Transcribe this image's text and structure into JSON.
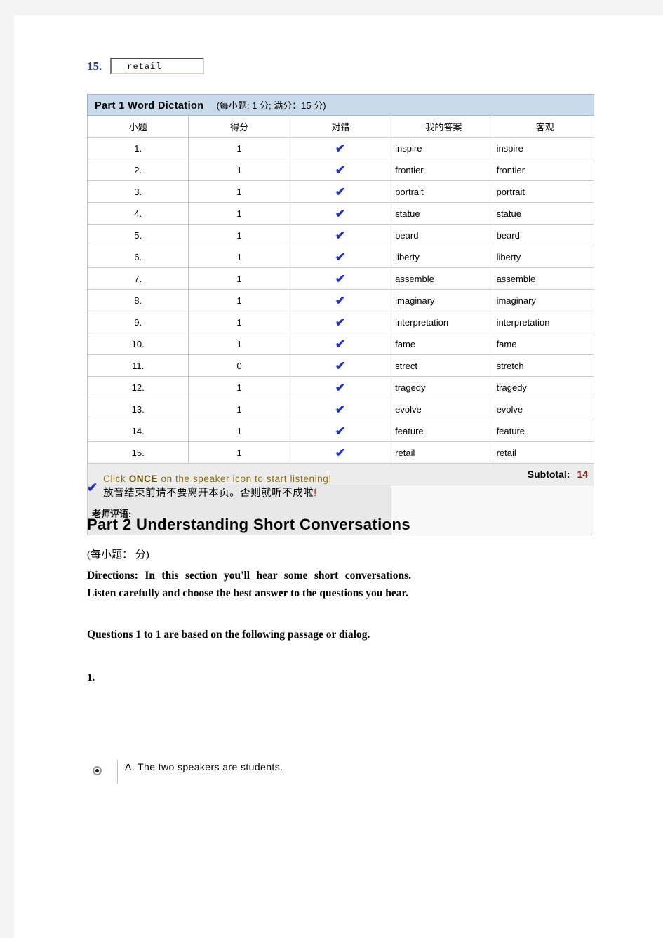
{
  "question15": {
    "number": "15.",
    "input_value": "retail",
    "input_placeholder": ""
  },
  "results_table": {
    "title_main": "Part 1 Word Dictation",
    "title_sub": "(每小题: 1 分; 满分：15 分)",
    "columns": [
      "小题",
      "得分",
      "对错",
      "我的答案",
      "客观"
    ],
    "mark_icon": "check-icon",
    "mark_glyph": "✔",
    "rows": [
      {
        "num": "1.",
        "score": "1",
        "mark": "✔",
        "mine": "inspire",
        "key": "inspire"
      },
      {
        "num": "2.",
        "score": "1",
        "mark": "✔",
        "mine": "frontier",
        "key": "frontier"
      },
      {
        "num": "3.",
        "score": "1",
        "mark": "✔",
        "mine": "portrait",
        "key": "portrait"
      },
      {
        "num": "4.",
        "score": "1",
        "mark": "✔",
        "mine": "statue",
        "key": "statue"
      },
      {
        "num": "5.",
        "score": "1",
        "mark": "✔",
        "mine": "beard",
        "key": "beard"
      },
      {
        "num": "6.",
        "score": "1",
        "mark": "✔",
        "mine": "liberty",
        "key": "liberty"
      },
      {
        "num": "7.",
        "score": "1",
        "mark": "✔",
        "mine": "assemble",
        "key": "assemble"
      },
      {
        "num": "8.",
        "score": "1",
        "mark": "✔",
        "mine": "imaginary",
        "key": "imaginary"
      },
      {
        "num": "9.",
        "score": "1",
        "mark": "✔",
        "mine": "interpretation",
        "key": "interpretation"
      },
      {
        "num": "10.",
        "score": "1",
        "mark": "✔",
        "mine": "fame",
        "key": "fame"
      },
      {
        "num": "11.",
        "score": "0",
        "mark": "✔",
        "mine": "strect",
        "key": "stretch"
      },
      {
        "num": "12.",
        "score": "1",
        "mark": "✔",
        "mine": "tragedy",
        "key": "tragedy"
      },
      {
        "num": "13.",
        "score": "1",
        "mark": "✔",
        "mine": "evolve",
        "key": "evolve"
      },
      {
        "num": "14.",
        "score": "1",
        "mark": "✔",
        "mine": "feature",
        "key": "feature"
      },
      {
        "num": "15.",
        "score": "1",
        "mark": "✔",
        "mine": "retail",
        "key": "retail"
      }
    ],
    "subtotal_label": "Subtotal:",
    "subtotal_value": "14",
    "comment_label": "老师评语:",
    "comment_value": ""
  },
  "notice": {
    "check_glyph": "✔",
    "en_before": "Click ",
    "en_bold": "ONCE",
    "en_after": " on the speaker icon to start listening!",
    "cn_text": "放音结束前请不要离开本页。否则就听不成啦",
    "cn_bang": "!"
  },
  "part2": {
    "title": "Part 2 Understanding Short Conversations",
    "subtitle": "(每小题： 分)",
    "directions": "Directions: In this section you'll hear some short conversations. Listen carefully and choose the best answer to the questions you hear.",
    "questions_line": "Questions 1 to 1 are based on the following passage or dialog.",
    "question_number": "1.",
    "choice_a": "A. The two speakers are students."
  },
  "colors": {
    "table_header_bg": "#c9dbeb",
    "check_blue": "#2030c0",
    "subtotal_red": "#8b1a1a",
    "notice_gold": "#8a6a12",
    "question_number_blue": "#1a3c8c"
  }
}
